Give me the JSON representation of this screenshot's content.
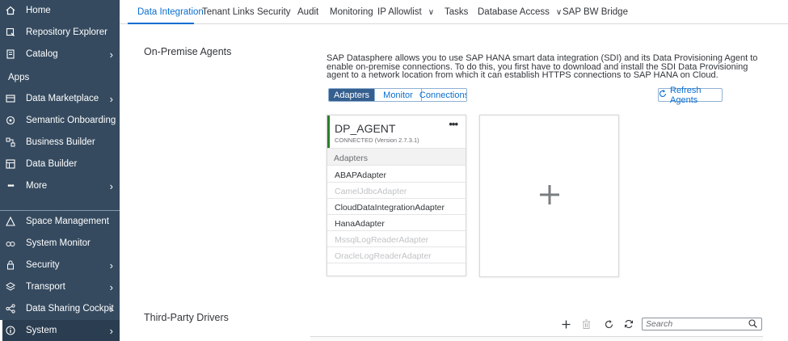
{
  "sidebar": {
    "items": [
      {
        "label": "Home",
        "icon": "home-icon",
        "chevron": false
      },
      {
        "label": "Repository Explorer",
        "icon": "repository-icon",
        "chevron": false
      },
      {
        "label": "Catalog",
        "icon": "catalog-icon",
        "chevron": true
      }
    ],
    "group_label": "Apps",
    "app_items": [
      {
        "label": "Data Marketplace",
        "icon": "marketplace-icon",
        "chevron": true
      },
      {
        "label": "Semantic Onboarding",
        "icon": "semantic-icon",
        "chevron": false
      },
      {
        "label": "Business Builder",
        "icon": "business-builder-icon",
        "chevron": false
      },
      {
        "label": "Data Builder",
        "icon": "data-builder-icon",
        "chevron": false
      },
      {
        "label": "More",
        "icon": "more-icon",
        "chevron": true
      }
    ],
    "bottom_items": [
      {
        "label": "Space Management",
        "icon": "space-management-icon",
        "chevron": false
      },
      {
        "label": "System Monitor",
        "icon": "system-monitor-icon",
        "chevron": false
      },
      {
        "label": "Security",
        "icon": "security-icon",
        "chevron": true
      },
      {
        "label": "Transport",
        "icon": "transport-icon",
        "chevron": true
      },
      {
        "label": "Data Sharing Cockpit",
        "icon": "share-icon",
        "chevron": true
      },
      {
        "label": "System",
        "icon": "info-icon",
        "chevron": true
      }
    ]
  },
  "tabs": {
    "items": [
      "Data Integration",
      "Tenant Links",
      "Security",
      "Audit",
      "Monitoring",
      "IP Allowlist",
      "Tasks",
      "Database Access",
      "SAP BW Bridge"
    ],
    "active": "Data Integration"
  },
  "on_premise": {
    "title": "On-Premise Agents",
    "description": "SAP Datasphere allows you to use SAP HANA smart data integration (SDI) and its Data Provisioning Agent to enable on-premise connections. To do this, you first have to download and install the SDI Data Provisioning agent to a network location from which it can establish HTTPS connections to SAP HANA on Cloud.",
    "segments": [
      "Adapters",
      "Monitor",
      "Connections"
    ],
    "selected_segment": "Adapters",
    "refresh_label": "Refresh Agents"
  },
  "agent": {
    "name": "DP_AGENT",
    "more": "•••",
    "status": "CONNECTED (Version 2.7.3.1)",
    "adapters_header": "Adapters",
    "adapters": [
      {
        "name": "ABAPAdapter",
        "enabled": true
      },
      {
        "name": "CamelJdbcAdapter",
        "enabled": false
      },
      {
        "name": "CloudDataIntegrationAdapter",
        "enabled": true
      },
      {
        "name": "HanaAdapter",
        "enabled": true
      },
      {
        "name": "MssqlLogReaderAdapter",
        "enabled": false
      },
      {
        "name": "OracleLogReaderAdapter",
        "enabled": false
      }
    ]
  },
  "third_party": {
    "title": "Third-Party Drivers",
    "search_placeholder": "Search"
  },
  "colors": {
    "sidebar_bg": "#354a5f",
    "accent": "#0a6ed1",
    "connected": "#2b7d2b"
  }
}
